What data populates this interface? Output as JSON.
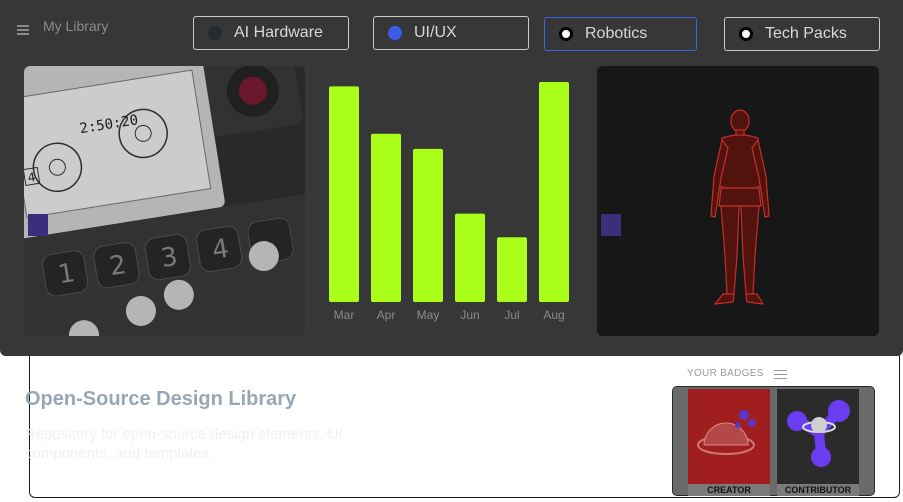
{
  "header": {
    "title": "My Library"
  },
  "tabs": [
    {
      "label": "AI Hardware",
      "dot_color": "#262b30"
    },
    {
      "label": "UI/UX",
      "dot_color": "#3a5be8"
    },
    {
      "label": "Robotics",
      "dot_color": "#ffffff",
      "active": true
    },
    {
      "label": "Tech Packs",
      "dot_color": "#ffffff"
    }
  ],
  "device_card": {
    "display_time": "2:50:20",
    "display_badge": "4",
    "keys": [
      "1",
      "2",
      "3",
      "4"
    ]
  },
  "chart_data": {
    "type": "bar",
    "categories": [
      "Mar",
      "Apr",
      "May",
      "Jun",
      "Jul",
      "Aug"
    ],
    "values": [
      100,
      78,
      71,
      41,
      30,
      102
    ],
    "ylim": [
      0,
      102
    ],
    "bar_color": "#aaff1a",
    "title": "",
    "xlabel": "",
    "ylabel": "",
    "grid": false
  },
  "library": {
    "title": "Open-Source Design Library",
    "description": "Repository for open-source design elements, UI components, and templates."
  },
  "badges": {
    "label": "YOUR BADGES",
    "items": [
      {
        "caption": "CREATOR",
        "icon": "planet-icon"
      },
      {
        "caption": "CONTRIBUTOR",
        "icon": "network-icon"
      }
    ]
  },
  "colors": {
    "panel": "#373737",
    "accent_border": "#3a64e0",
    "bar": "#aaff1a"
  }
}
